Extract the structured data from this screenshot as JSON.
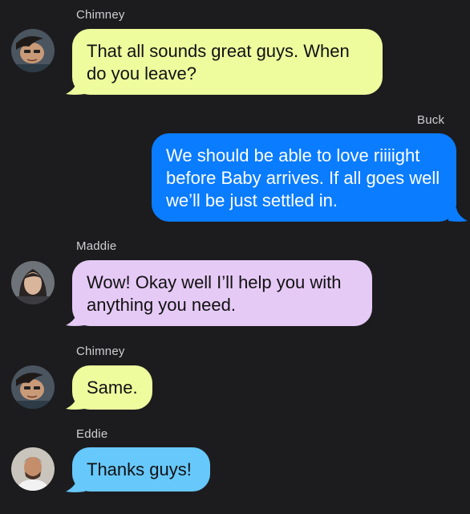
{
  "messages": [
    {
      "sender": "Chimney",
      "text": "That all sounds great guys. When do you leave?",
      "bubble_color": "#eefc9e",
      "direction": "incoming"
    },
    {
      "sender": "Buck",
      "text": "We should be able to love riiiight before Baby arrives. If all goes well we’ll be just settled in.",
      "bubble_color": "#0a7cff",
      "direction": "outgoing"
    },
    {
      "sender": "Maddie",
      "text": "Wow! Okay well I’ll help you with anything you need.",
      "bubble_color": "#e6caf6",
      "direction": "incoming"
    },
    {
      "sender": "Chimney",
      "text": "Same.",
      "bubble_color": "#eefc9e",
      "direction": "incoming"
    },
    {
      "sender": "Eddie",
      "text": "Thanks guys!",
      "bubble_color": "#67c8fb",
      "direction": "incoming"
    }
  ],
  "colors": {
    "background": "#1c1c1e",
    "sender_label": "#cfcfd4"
  }
}
